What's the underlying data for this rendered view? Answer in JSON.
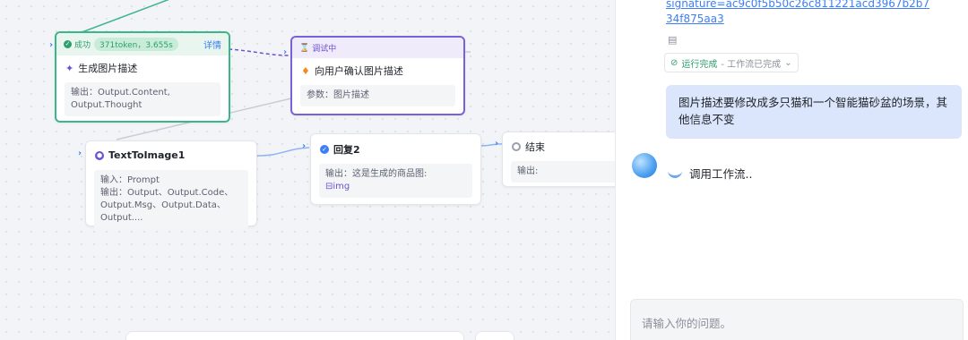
{
  "nodes": {
    "describe": {
      "status_label": "成功",
      "status_pill": "371token，3.655s",
      "detail_label": "详情",
      "title": "生成图片描述",
      "output": "输出：Output.Content, Output.Thought"
    },
    "confirm": {
      "status_label": "调试中",
      "title": "向用户确认图片描述",
      "params": "参数：图片描述"
    },
    "text_to_image": {
      "title": "TextToImage1",
      "input": "输入：Prompt",
      "output": "输出：Output、Output.Code、Output.Msg、Output.Data、Output...."
    },
    "reply": {
      "title": "回复2",
      "output_line": "输出：这是生成的商品图:",
      "img_tag": "img"
    },
    "end": {
      "title": "结束",
      "output": "输出:"
    }
  },
  "chat": {
    "link_text": "signature=ac9c0f5b50c26c811221acd3967b2b734f875aa3",
    "run_status": "运行完成",
    "run_status_sub": "- 工作流已完成",
    "user_message": "图片描述要修改成多只猫和一个智能猫砂盆的场景，其他信息不变",
    "bot_message": "调用工作流..",
    "input_placeholder": "请输入你的问题。"
  },
  "colors": {
    "success": "#2f9e6c",
    "running": "#6d4fd2",
    "link": "#3c7ef6",
    "user_bubble": "#dbe6fc"
  }
}
